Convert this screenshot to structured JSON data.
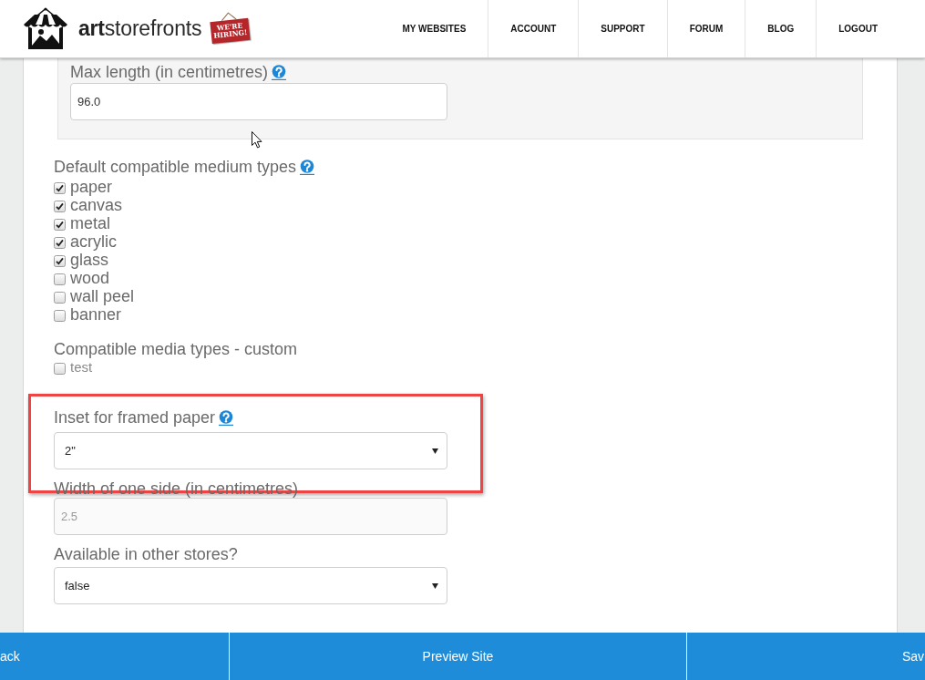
{
  "header": {
    "logo_text": "**art**storefronts",
    "hiring_sign": "WE'RE HIRING!",
    "nav": [
      {
        "label": "MY WEBSITES"
      },
      {
        "label": "ACCOUNT"
      },
      {
        "label": "SUPPORT"
      },
      {
        "label": "FORUM"
      },
      {
        "label": "BLOG"
      },
      {
        "label": "LOGOUT"
      }
    ]
  },
  "form": {
    "length_panel": {
      "label": "Max length (in centimetres)",
      "help": true,
      "value": "96.0"
    },
    "medium_types": {
      "label": "Default compatible medium types",
      "help": true,
      "options": [
        {
          "label": "paper",
          "checked": true
        },
        {
          "label": "canvas",
          "checked": true
        },
        {
          "label": "metal",
          "checked": true
        },
        {
          "label": "acrylic",
          "checked": true
        },
        {
          "label": "glass",
          "checked": true
        },
        {
          "label": "wood",
          "checked": false
        },
        {
          "label": "wall peel",
          "checked": false
        },
        {
          "label": "banner",
          "checked": false
        }
      ]
    },
    "custom_media": {
      "label": "Compatible media types - custom",
      "help": false,
      "options": [
        {
          "label": "test",
          "checked": false
        }
      ]
    },
    "fields": [
      {
        "kind": "select",
        "label": "Inset for framed paper",
        "help": true,
        "value": "2\"",
        "disabled": false,
        "highlighted": true
      },
      {
        "kind": "text",
        "label": "Width of one side (in centimetres)",
        "help": false,
        "value": "2.5",
        "disabled": true,
        "highlighted": false
      },
      {
        "kind": "select",
        "label": "Available in other stores?",
        "help": false,
        "value": "false",
        "disabled": false,
        "highlighted": false
      }
    ]
  },
  "footer_buttons": [
    {
      "label": "ack"
    },
    {
      "label": "Preview Site"
    },
    {
      "label": "Sav"
    }
  ]
}
